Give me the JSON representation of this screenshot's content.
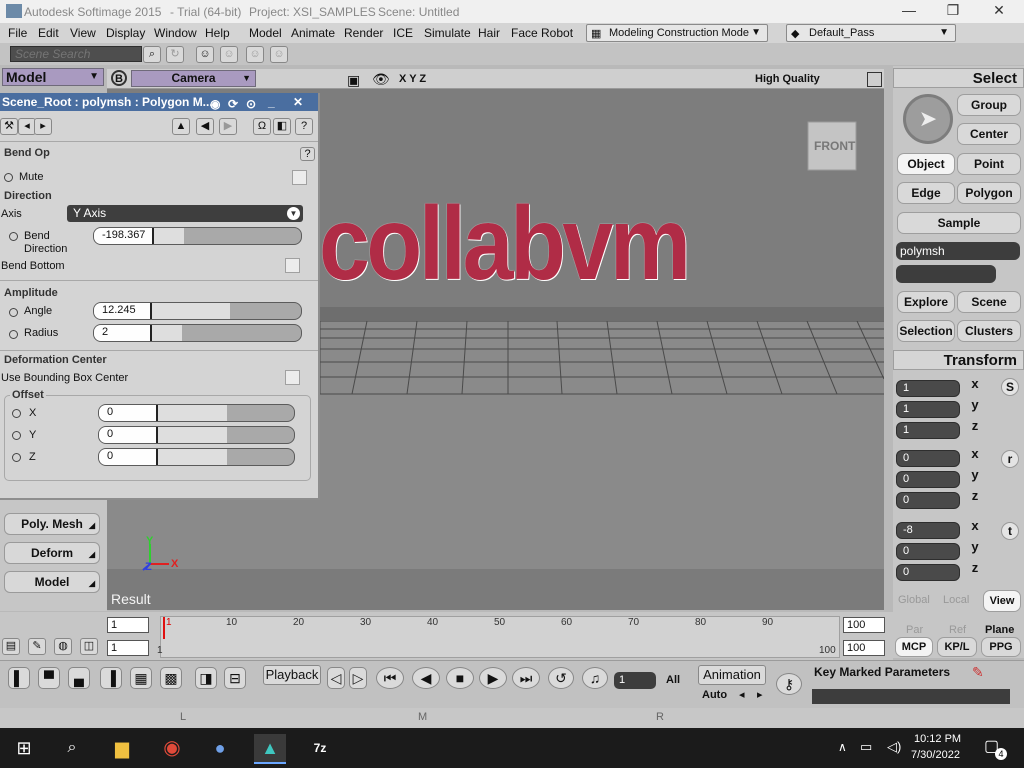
{
  "window": {
    "app_title": "Autodesk Softimage 2015",
    "trial": "- Trial (64-bit)",
    "project": "Project: XSI_SAMPLES",
    "scene": "Scene: Untitled",
    "min": "—",
    "max": "❐",
    "close": "✕"
  },
  "menu": {
    "items": [
      "File",
      "Edit",
      "View",
      "Display",
      "Window",
      "Help",
      "Model",
      "Animate",
      "Render",
      "ICE",
      "Simulate",
      "Hair",
      "Face Robot"
    ],
    "mode": "Modeling Construction Mode",
    "pass": "Default_Pass"
  },
  "search": {
    "placeholder": "Scene Search"
  },
  "left": {
    "model": "Model",
    "buttons": [
      "Poly. Mesh",
      "Deform",
      "Model"
    ]
  },
  "viewport": {
    "label_b": "B",
    "camera": "Camera",
    "axes": "X Y Z",
    "quality": "High Quality",
    "cube_label": "FRONT",
    "text3d": "collabvm",
    "axis_y": "Y",
    "axis_z": "Z",
    "axis_x": "X",
    "result": "Result"
  },
  "ppg": {
    "title": "Scene_Root : polymsh : Polygon M...",
    "header": "Bend Op",
    "help": "?",
    "mute": "Mute",
    "direction": "Direction",
    "axis_label": "Axis",
    "axis_value": "Y Axis",
    "bend_label": "Bend",
    "bend_label2": "Direction",
    "bend_value": "-198.367",
    "bend_bottom": "Bend Bottom",
    "amplitude": "Amplitude",
    "angle_label": "Angle",
    "angle_value": "12.245",
    "radius_label": "Radius",
    "radius_value": "2",
    "deform_center": "Deformation Center",
    "use_bbox": "Use Bounding Box Center",
    "offset": "Offset",
    "x_label": "X",
    "x_value": "0",
    "y_label": "Y",
    "y_value": "0",
    "z_label": "Z",
    "z_value": "0"
  },
  "right": {
    "select": "Select",
    "group": "Group",
    "center": "Center",
    "object": "Object",
    "point": "Point",
    "edge": "Edge",
    "polygon": "Polygon",
    "sample": "Sample",
    "selection_name": "polymsh",
    "explore": "Explore",
    "scene": "Scene",
    "selection": "Selection",
    "clusters": "Clusters",
    "transform": "Transform",
    "scale": [
      "1",
      "1",
      "1"
    ],
    "rotate": [
      "0",
      "0",
      "0"
    ],
    "translate": [
      "-8",
      "0",
      "0"
    ],
    "x": "x",
    "y": "y",
    "z": "z",
    "s": "S",
    "r": "r",
    "t": "t",
    "global": "Global",
    "local": "Local",
    "view": "View",
    "par": "Par",
    "ref": "Ref",
    "plane": "Plane",
    "mcp": "MCP",
    "kpl": "KP/L",
    "ppg": "PPG"
  },
  "timeline": {
    "start": "1",
    "start2": "1",
    "marker": "1",
    "ticks": [
      "1",
      "10",
      "20",
      "30",
      "40",
      "50",
      "60",
      "70",
      "80",
      "90"
    ],
    "end_small": "100",
    "end1": "100",
    "end2": "100"
  },
  "playback": {
    "playback": "Playback",
    "frame": "1",
    "all": "All",
    "animation": "Animation",
    "auto": "Auto",
    "key_marked": "Key Marked Parameters"
  },
  "lmr": [
    "L",
    "M",
    "R"
  ],
  "taskbar": {
    "time": "10:12 PM",
    "date": "7/30/2022",
    "notif": "4"
  },
  "colors": {
    "text3d": "#b02c46",
    "titlebar": "#4a6ea0"
  }
}
